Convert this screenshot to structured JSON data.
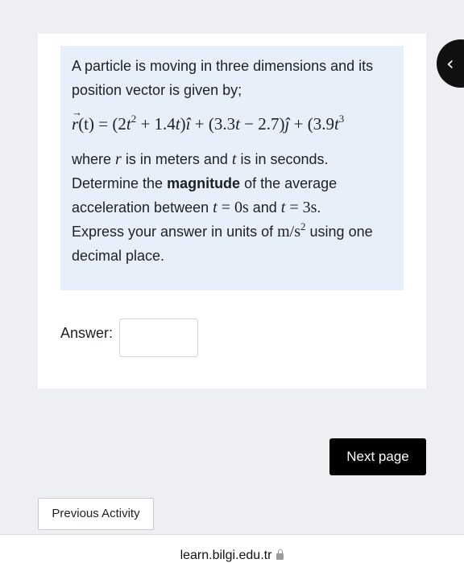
{
  "question": {
    "intro": "A particle is moving in three dimensions and its position vector is given by;",
    "formula": {
      "lhs_var": "r",
      "lhs_arg": "(t) = (2",
      "t1": "t",
      "exp1": "2",
      "part2": " + 1.4",
      "t2": "t",
      "part3": ")",
      "i_hat": "î",
      "part4": " + (3.3",
      "t3": "t",
      "part5": " − 2.7)",
      "j_hat": "ĵ",
      "part6": " + (3.9",
      "t4": "t",
      "exp2": "3"
    },
    "where_text": "where ",
    "var_r": "r",
    "meters_text": " is in meters and ",
    "var_t": "t",
    "seconds_text": " is in seconds.",
    "determine_text": "Determine the ",
    "magnitude": "magnitude",
    "of_avg_text": " of the average acceleration between ",
    "t_start_var": "t",
    "t_start_val": " = 0s",
    "and_text": " and ",
    "t_end_var": "t",
    "t_end_val": " = 3s",
    "period": ".",
    "express_text": "Express your answer in units of ",
    "unit_base": "m/s",
    "unit_exp": "2",
    "using_text": " using one decimal place."
  },
  "answer": {
    "label": "Answer:",
    "value": ""
  },
  "navigation": {
    "next_label": "Next page",
    "prev_label": "Previous Activity",
    "drawer_icon": "‹"
  },
  "browser": {
    "url": "learn.bilgi.edu.tr"
  },
  "icons": {
    "drawer": "chevron-left-icon",
    "lock": "lock-icon"
  },
  "colors": {
    "page_bg": "#edeff2",
    "question_bg": "#e7f0fa",
    "button_dark": "#000000"
  }
}
